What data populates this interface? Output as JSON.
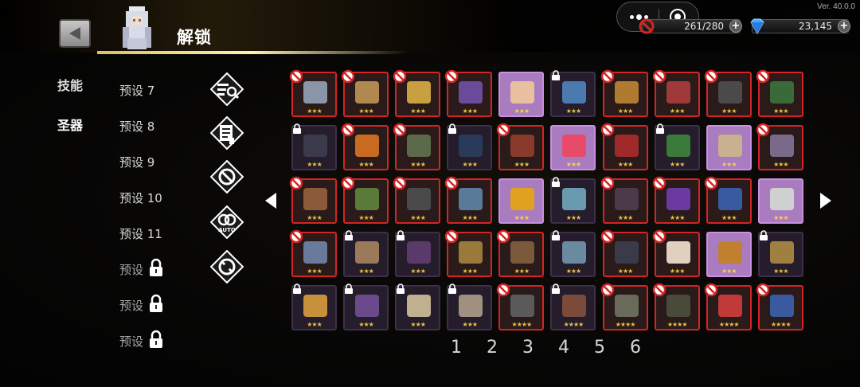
{
  "header": {
    "title": "解锁",
    "back_caption": "",
    "version": "Ver. 40.0.0",
    "stamina": "261/280",
    "gems": "23,145"
  },
  "nav": {
    "skills": "技能",
    "artifacts": "圣器"
  },
  "presets": [
    {
      "label": "预设 7",
      "locked": false
    },
    {
      "label": "预设 8",
      "locked": false
    },
    {
      "label": "预设 9",
      "locked": false
    },
    {
      "label": "预设 10",
      "locked": false
    },
    {
      "label": "预设 11",
      "locked": false
    },
    {
      "label": "预设",
      "locked": true
    },
    {
      "label": "预设",
      "locked": true
    },
    {
      "label": "预设",
      "locked": true
    }
  ],
  "tools": [
    "search-filter-icon",
    "scroll-icon",
    "ban-icon",
    "auto-icon",
    "ban-outline-icon"
  ],
  "pages": [
    "1",
    "2",
    "3",
    "4",
    "5",
    "6"
  ],
  "colors": {
    "banned_border": "#d42424",
    "selected_bg": "#a97cc0",
    "star": "#e8c040"
  },
  "grid_rows": [
    [
      {
        "s": "red",
        "m": "ban",
        "c": "#8a95a8",
        "r": 3
      },
      {
        "s": "red",
        "m": "ban",
        "c": "#b08850",
        "r": 3
      },
      {
        "s": "red",
        "m": "ban",
        "c": "#c8a040",
        "r": 3
      },
      {
        "s": "red",
        "m": "ban",
        "c": "#6a4a9a",
        "r": 3
      },
      {
        "s": "purple",
        "m": "",
        "c": "#e8c0a0",
        "r": 3
      },
      {
        "s": "dark",
        "m": "lock",
        "c": "#4a7ab0",
        "r": 3
      },
      {
        "s": "red",
        "m": "ban",
        "c": "#b07a30",
        "r": 3
      },
      {
        "s": "red",
        "m": "ban",
        "c": "#a03a3a",
        "r": 3
      },
      {
        "s": "red",
        "m": "ban",
        "c": "#4a4a4a",
        "r": 3
      },
      {
        "s": "red",
        "m": "ban",
        "c": "#3a6a3a",
        "r": 3
      }
    ],
    [
      {
        "s": "dark",
        "m": "lock",
        "c": "#3a3a4a",
        "r": 3
      },
      {
        "s": "red",
        "m": "ban",
        "c": "#c86a20",
        "r": 3
      },
      {
        "s": "red",
        "m": "ban",
        "c": "#5a6a4a",
        "r": 3
      },
      {
        "s": "dark",
        "m": "lock",
        "c": "#2a3a5a",
        "r": 3
      },
      {
        "s": "red",
        "m": "ban",
        "c": "#8a3a2a",
        "r": 3
      },
      {
        "s": "purple",
        "m": "",
        "c": "#e84a6a",
        "r": 3
      },
      {
        "s": "red",
        "m": "ban",
        "c": "#a02a2a",
        "r": 3
      },
      {
        "s": "dark",
        "m": "lock",
        "c": "#3a7a3a",
        "r": 3
      },
      {
        "s": "purple",
        "m": "",
        "c": "#c8b090",
        "r": 3
      },
      {
        "s": "red",
        "m": "ban",
        "c": "#7a6a8a",
        "r": 3
      }
    ],
    [
      {
        "s": "red",
        "m": "ban",
        "c": "#8a5a3a",
        "r": 3
      },
      {
        "s": "red",
        "m": "ban",
        "c": "#5a7a3a",
        "r": 3
      },
      {
        "s": "red",
        "m": "ban",
        "c": "#4a4a4a",
        "r": 3
      },
      {
        "s": "red",
        "m": "ban",
        "c": "#5a7a9a",
        "r": 3
      },
      {
        "s": "purple",
        "m": "",
        "c": "#e0a020",
        "r": 3
      },
      {
        "s": "dark",
        "m": "lock",
        "c": "#6a9ab0",
        "r": 3
      },
      {
        "s": "red",
        "m": "ban",
        "c": "#4a3a4a",
        "r": 3
      },
      {
        "s": "red",
        "m": "ban",
        "c": "#6a3aa0",
        "r": 3
      },
      {
        "s": "red",
        "m": "ban",
        "c": "#3a5aa0",
        "r": 3
      },
      {
        "s": "purple",
        "m": "",
        "c": "#d0d0d0",
        "r": 3
      }
    ],
    [
      {
        "s": "red",
        "m": "ban",
        "c": "#6a7a9a",
        "r": 3
      },
      {
        "s": "dark",
        "m": "lock",
        "c": "#9a7a5a",
        "r": 3
      },
      {
        "s": "dark",
        "m": "lock",
        "c": "#5a3a6a",
        "r": 3
      },
      {
        "s": "red",
        "m": "ban",
        "c": "#9a7a3a",
        "r": 3
      },
      {
        "s": "red",
        "m": "ban",
        "c": "#7a5a3a",
        "r": 3
      },
      {
        "s": "dark",
        "m": "lock",
        "c": "#6a8aa0",
        "r": 3
      },
      {
        "s": "red",
        "m": "ban",
        "c": "#3a3a4a",
        "r": 3
      },
      {
        "s": "red",
        "m": "ban",
        "c": "#e0d0c0",
        "r": 3
      },
      {
        "s": "purple",
        "m": "",
        "c": "#c08030",
        "r": 3
      },
      {
        "s": "dark",
        "m": "lock",
        "c": "#a08040",
        "r": 3
      }
    ],
    [
      {
        "s": "dark",
        "m": "lock",
        "c": "#c8903a",
        "r": 3
      },
      {
        "s": "dark",
        "m": "lock",
        "c": "#6a4a8a",
        "r": 3
      },
      {
        "s": "dark",
        "m": "lock",
        "c": "#c0b090",
        "r": 3
      },
      {
        "s": "dark",
        "m": "lock",
        "c": "#a09080",
        "r": 3
      },
      {
        "s": "red",
        "m": "ban",
        "c": "#5a5a5a",
        "r": 4
      },
      {
        "s": "dark",
        "m": "lock",
        "c": "#7a4a3a",
        "r": 4
      },
      {
        "s": "red",
        "m": "ban",
        "c": "#6a6a5a",
        "r": 4
      },
      {
        "s": "red",
        "m": "ban",
        "c": "#4a4a3a",
        "r": 4
      },
      {
        "s": "red",
        "m": "ban",
        "c": "#c03a3a",
        "r": 4
      },
      {
        "s": "red",
        "m": "ban",
        "c": "#3a5aa0",
        "r": 4
      }
    ]
  ]
}
